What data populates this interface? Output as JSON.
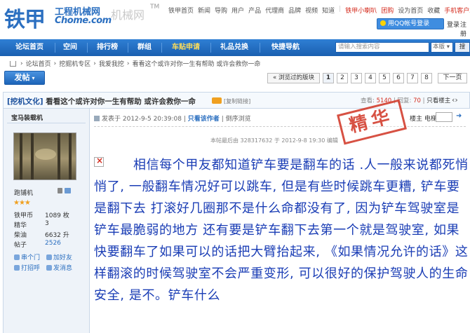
{
  "header": {
    "logo_main": "铁甲",
    "logo_sub": "工程机械网",
    "logo_url": "Chome.com",
    "logo_ghost": "机械网",
    "logo_tm": "TM",
    "top_links": [
      "铁甲首页",
      "新闻",
      "导购",
      "用户",
      "产品",
      "代理商",
      "品牌",
      "视频",
      "知道"
    ],
    "top_right_links": [
      "铁甲小喇叭",
      "团购",
      "设为首页",
      "收藏",
      "手机客户端"
    ],
    "qq_login": "用QQ帐号登录",
    "login": "登录",
    "register": "注册"
  },
  "nav": {
    "items": [
      "论坛首页",
      "空间",
      "排行榜",
      "群组",
      "车贴申请",
      "礼品兑换",
      "快捷导航"
    ],
    "active_index": 4,
    "search_placeholder": "请输入搜索内容",
    "search_scope": "本版",
    "search_button": "搜"
  },
  "breadcrumb": [
    "论坛首页",
    "挖掘机专区",
    "我爱我挖",
    "看看这个或许对你一生有帮助 或许会救你一命"
  ],
  "toolbar": {
    "post_label": "发帖",
    "back_label": "« 浏览过的版块",
    "pages": [
      "1",
      "2",
      "3",
      "4",
      "5",
      "6",
      "7",
      "8"
    ],
    "current_page": "1",
    "next_label": "下一页"
  },
  "thread": {
    "category": "[挖机文化]",
    "title": "看看这个或许对你一生有帮助 或许会救你一命",
    "copy_link": "[复制链接]",
    "views_label": "查看:",
    "views": "5140",
    "replies_label": "回复:",
    "replies": "70",
    "only_author": "只看楼主"
  },
  "author": {
    "name": "宝马装载机",
    "rank": "跑铺机",
    "stars": "★★★",
    "stats": [
      {
        "label": "铁甲币",
        "value": "1089 枚"
      },
      {
        "label": "精华",
        "value": "3"
      },
      {
        "label": "柴油",
        "value": "6632 升"
      },
      {
        "label": "帖子",
        "value": "2526"
      }
    ],
    "actions": [
      "串个门",
      "加好友",
      "打招呼",
      "发消息"
    ]
  },
  "post": {
    "posted_prefix": "发表于 2012-9-5 20:39:08",
    "only_author": "只看该作者",
    "reverse": "倒序浏览",
    "floor_label": "楼主",
    "jump_label": "电梯直达",
    "edit_note": "本帖最后由 328317632 于 2012-9-8 19:30 编辑",
    "stamp": "精华",
    "body": "相信每个甲友都知道铲车要是翻车的话 .人一般来说都死悄悄了, 一般翻车情况好可以跳车, 但是有些时候跳车更糟, 铲车要是翻下去 打滚好几圈那不是什么命都没有了, 因为铲车驾驶室是铲车最脆弱的地方 还有要是铲车翻下去第一个就是驾驶室, 如果快要翻车了如果可以的话把大臂抬起来, 《如果情况允许的话》这样翻滚的时候驾驶室不会严重变形, 可以很好的保护驾驶人的生命安全, 是不。铲车什么"
  }
}
